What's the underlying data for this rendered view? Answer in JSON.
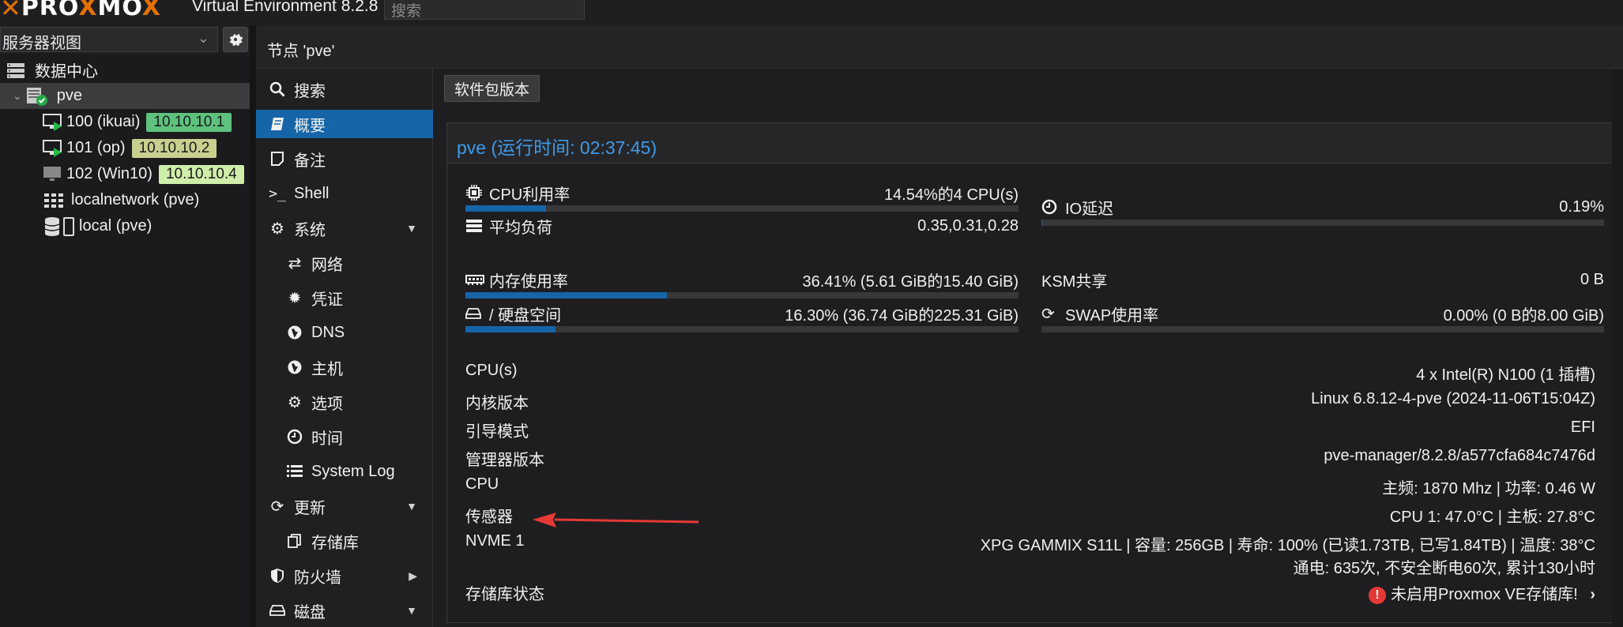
{
  "header": {
    "logo_left": "PRO",
    "logo_o": "X",
    "logo_right": "MO",
    "version": "Virtual Environment 8.2.8",
    "search_placeholder": "搜索"
  },
  "tree": {
    "view_select": "服务器视图",
    "items": [
      {
        "label": "数据中心"
      },
      {
        "label": "pve"
      },
      {
        "label": "100 (ikuai)",
        "ip": "10.10.10.1",
        "ip_color": "#5ec27e"
      },
      {
        "label": "101 (op)",
        "ip": "10.10.10.2",
        "ip_color": "#c9cf8f"
      },
      {
        "label": "102 (Win10)",
        "ip": "10.10.10.4",
        "ip_color": "#cfeeaa"
      },
      {
        "label": "localnetwork (pve)"
      },
      {
        "label": "local (pve)"
      }
    ]
  },
  "content": {
    "title": "节点 'pve'"
  },
  "nav": {
    "items": [
      {
        "label": "搜索",
        "icon": "search-icon"
      },
      {
        "label": "概要",
        "icon": "book-icon"
      },
      {
        "label": "备注",
        "icon": "note-icon"
      },
      {
        "label": "Shell",
        "icon": "terminal-icon"
      },
      {
        "label": "系统",
        "icon": "cogs-icon"
      },
      {
        "label": "网络",
        "icon": "exchange-icon"
      },
      {
        "label": "凭证",
        "icon": "certificate-icon"
      },
      {
        "label": "DNS",
        "icon": "globe-icon"
      },
      {
        "label": "主机",
        "icon": "globe-icon"
      },
      {
        "label": "选项",
        "icon": "gear-icon"
      },
      {
        "label": "时间",
        "icon": "clock-icon"
      },
      {
        "label": "System Log",
        "icon": "list-icon"
      },
      {
        "label": "更新",
        "icon": "refresh-icon"
      },
      {
        "label": "存储库",
        "icon": "files-icon"
      },
      {
        "label": "防火墙",
        "icon": "shield-icon"
      },
      {
        "label": "磁盘",
        "icon": "hdd-icon"
      }
    ]
  },
  "toolbar": {
    "package_versions": "软件包版本"
  },
  "summary": {
    "title": "pve (运行时间: 02:37:45)",
    "cpu_usage_label": "CPU利用率",
    "cpu_usage_value": "14.54%的4 CPU(s)",
    "cpu_usage_fraction": 0.1454,
    "load_label": "平均负荷",
    "load_value": "0.35,0.31,0.28",
    "io_label": "IO延迟",
    "io_value": "0.19%",
    "io_fraction": 0.0019,
    "mem_label": "内存使用率",
    "mem_value": "36.41% (5.61 GiB的15.40 GiB)",
    "mem_fraction": 0.3641,
    "ksm_label": "KSM共享",
    "ksm_value": "0 B",
    "disk_label": "/ 硬盘空间",
    "disk_value": "16.30% (36.74 GiB的225.31 GiB)",
    "disk_fraction": 0.163,
    "swap_label": "SWAP使用率",
    "swap_value": "0.00% (0 B的8.00 GiB)",
    "swap_fraction": 0.0,
    "info": [
      {
        "label": "CPU(s)",
        "value": "4 x Intel(R) N100 (1 插槽)"
      },
      {
        "label": "内核版本",
        "value": "Linux 6.8.12-4-pve (2024-11-06T15:04Z)"
      },
      {
        "label": "引导模式",
        "value": "EFI"
      },
      {
        "label": "管理器版本",
        "value": "pve-manager/8.2.8/a577cfa684c7476d"
      },
      {
        "label": "CPU",
        "value": "主频: 1870 Mhz | 功率: 0.46 W"
      },
      {
        "label": "传感器",
        "value": "CPU 1: 47.0°C | 主板: 27.8°C"
      },
      {
        "label": "NVME 1",
        "value": "XPG GAMMIX S11L | 容量: 256GB | 寿命: 100% (已读1.73TB, 已写1.84TB) | 温度: 38°C",
        "value2": "通电: 635次, 不安全断电60次, 累计130小时"
      },
      {
        "label": "存储库状态",
        "value": "未启用Proxmox VE存储库!"
      }
    ]
  },
  "colors": {
    "accent": "#1565a8",
    "title_blue": "#3e9ae8",
    "logo_orange": "#e57000",
    "alert_red": "#e53935",
    "arrow_red": "#e53935"
  }
}
